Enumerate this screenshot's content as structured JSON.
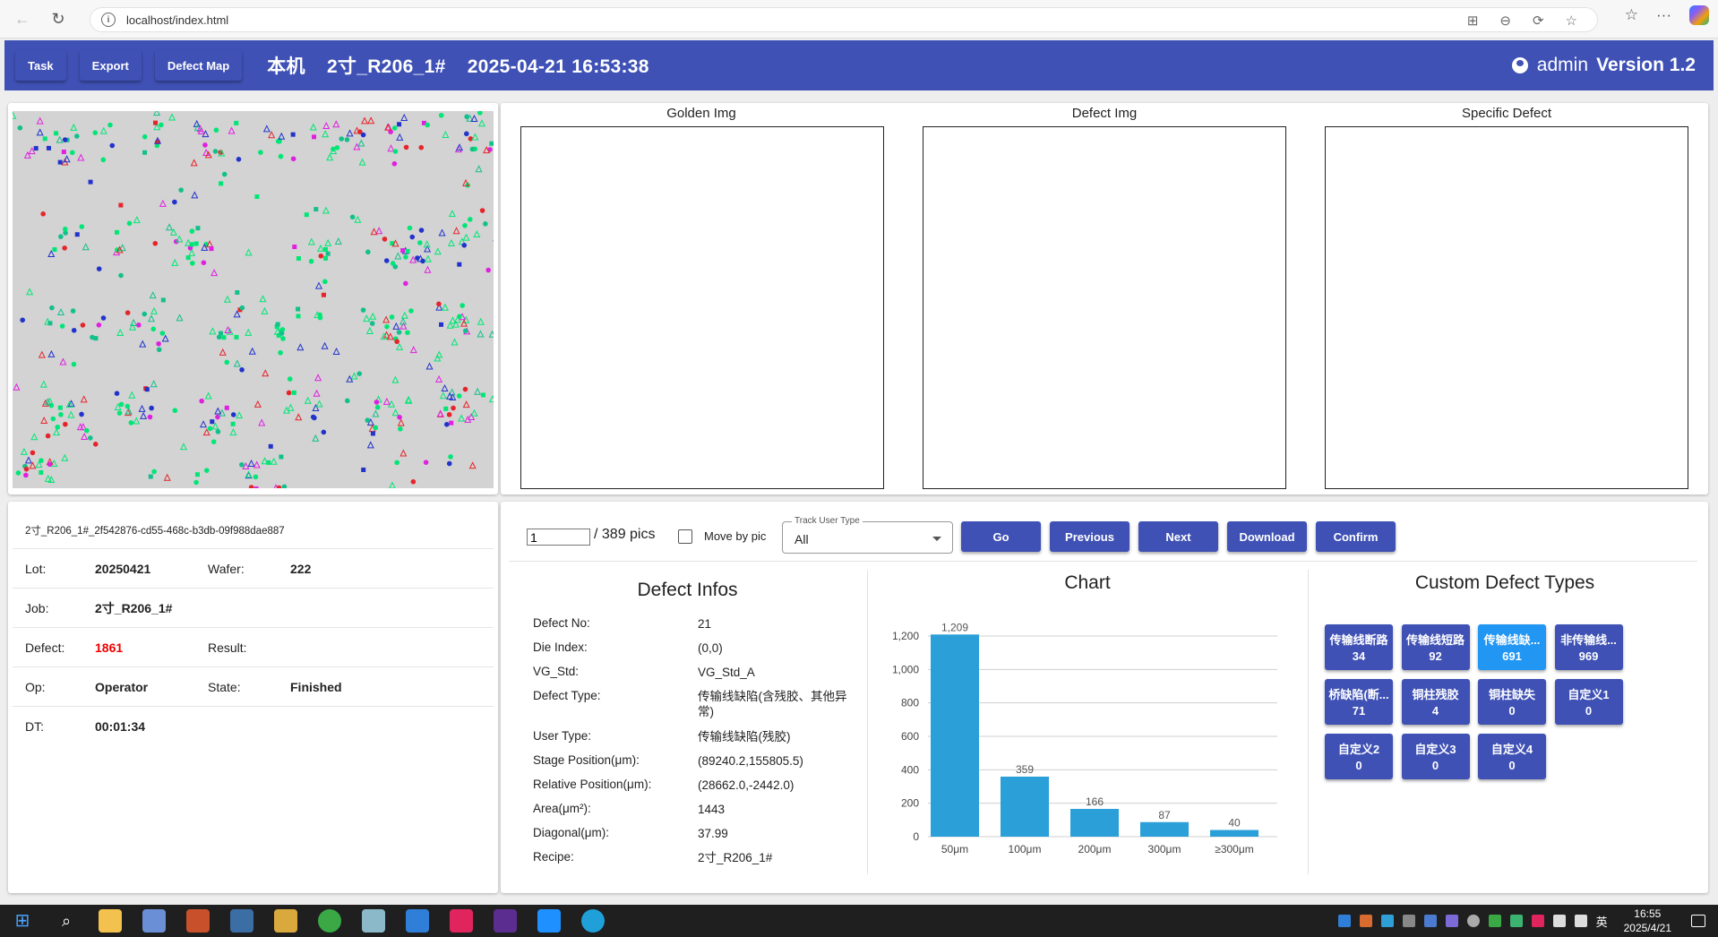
{
  "browser": {
    "url": "localhost/index.html"
  },
  "header": {
    "buttons": [
      "Task",
      "Export",
      "Defect Map"
    ],
    "machine": "本机",
    "job": "2寸_R206_1#",
    "datetime": "2025-04-21 16:53:38",
    "user": "admin",
    "version": "Version 1.2"
  },
  "images": {
    "golden": "Golden Img",
    "defect": "Defect Img",
    "specific": "Specific Defect"
  },
  "info": {
    "id": "2寸_R206_1#_2f542876-cd55-468c-b3db-09f988dae887",
    "lot_label": "Lot:",
    "lot": "20250421",
    "wafer_label": "Wafer:",
    "wafer": "222",
    "job_label": "Job:",
    "job": "2寸_R206_1#",
    "defect_label": "Defect:",
    "defect": "1861",
    "result_label": "Result:",
    "result": "",
    "op_label": "Op:",
    "op": "Operator",
    "state_label": "State:",
    "state": "Finished",
    "dt_label": "DT:",
    "dt": "00:01:34"
  },
  "controls": {
    "page_value": "1",
    "page_total": "/ 389 pics",
    "move_by_pic": "Move by pic",
    "track_label": "Track User Type",
    "track_value": "All",
    "go": "Go",
    "previous": "Previous",
    "next": "Next",
    "download": "Download",
    "confirm": "Confirm"
  },
  "defect_infos": {
    "title": "Defect Infos",
    "rows": [
      {
        "k": "Defect No:",
        "v": "21"
      },
      {
        "k": "Die Index:",
        "v": "(0,0)"
      },
      {
        "k": "VG_Std:",
        "v": "VG_Std_A"
      },
      {
        "k": "Defect Type:",
        "v": "传输线缺陷(含残胶、其他异常)"
      },
      {
        "k": "User Type:",
        "v": "传输线缺陷(残胶)"
      },
      {
        "k": "Stage Position(μm):",
        "v": "(89240.2,155805.5)"
      },
      {
        "k": "Relative Position(μm):",
        "v": "(28662.0,-2442.0)"
      },
      {
        "k": "Area(μm²):",
        "v": "1443"
      },
      {
        "k": "Diagonal(μm):",
        "v": "37.99"
      },
      {
        "k": "Recipe:",
        "v": "2寸_R206_1#"
      }
    ]
  },
  "chart_data": {
    "type": "bar",
    "title": "Chart",
    "categories": [
      "50μm",
      "100μm",
      "200μm",
      "300μm",
      "≥300μm"
    ],
    "values": [
      1209,
      359,
      166,
      87,
      40
    ],
    "value_labels": [
      "1,209",
      "359",
      "166",
      "87",
      "40"
    ],
    "yticks": [
      "0",
      "200",
      "400",
      "600",
      "800",
      "1,000",
      "1,200"
    ],
    "ylim": [
      0,
      1200
    ],
    "grid": true,
    "color": "#2a9fd8"
  },
  "custom_types": {
    "title": "Custom Defect Types",
    "items": [
      {
        "name": "传输线断路",
        "count": "34"
      },
      {
        "name": "传输线短路",
        "count": "92"
      },
      {
        "name": "传输线缺...",
        "count": "691"
      },
      {
        "name": "非传输线...",
        "count": "969"
      },
      {
        "name": "桥缺陷(断...",
        "count": "71"
      },
      {
        "name": "铜柱残胶",
        "count": "4"
      },
      {
        "name": "铜柱缺失",
        "count": "0"
      },
      {
        "name": "自定义1",
        "count": "0"
      },
      {
        "name": "自定义2",
        "count": "0"
      },
      {
        "name": "自定义3",
        "count": "0"
      },
      {
        "name": "自定义4",
        "count": "0"
      }
    ]
  },
  "taskbar": {
    "time": "16:55",
    "date": "2025/4/21",
    "ime": "英"
  },
  "colors": {
    "primary": "#3f51b5",
    "active": "#2196f3",
    "defect_count": "#ee0000"
  }
}
